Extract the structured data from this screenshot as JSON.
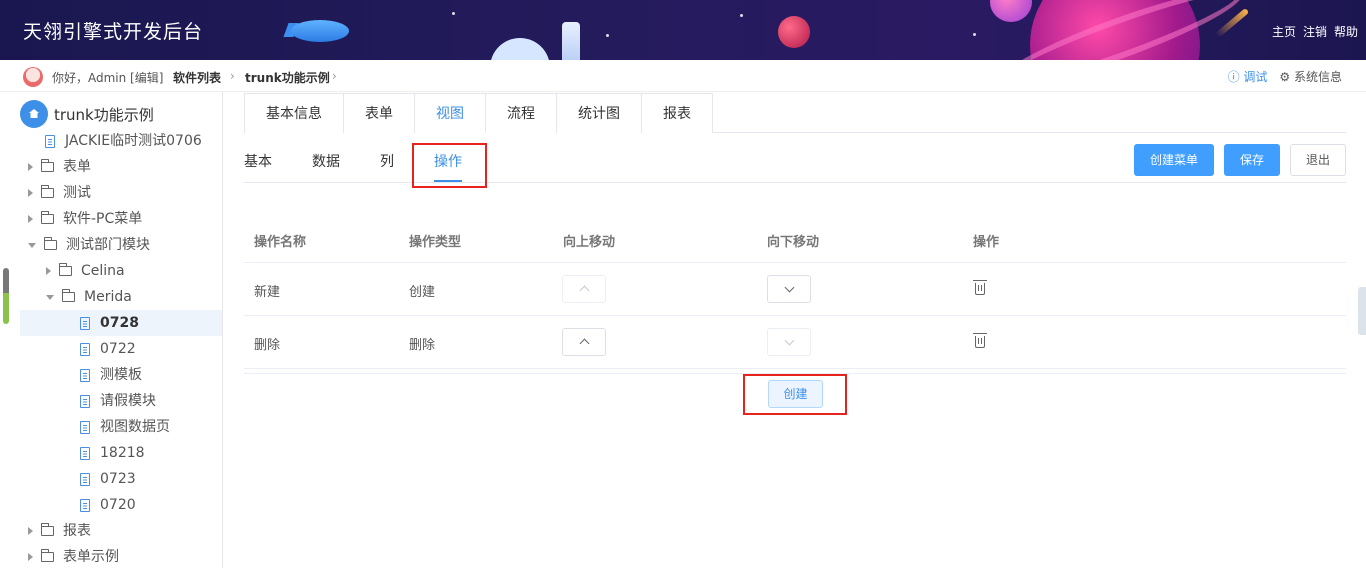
{
  "header": {
    "title": "天翎引擎式开发后台",
    "links": [
      "主页",
      "注销",
      "帮助"
    ]
  },
  "topbar": {
    "greeting": "你好，Admin [编辑]",
    "breadcrumb": [
      "软件列表",
      "trunk功能示例"
    ],
    "debug": "ⓘ 调试",
    "sysinfo": "⚙ 系统信息"
  },
  "sidebar": {
    "root": "trunk功能示例",
    "items": [
      {
        "label": "JACKIE临时测试0706",
        "type": "doc",
        "level": 1
      },
      {
        "label": "表单",
        "type": "folder",
        "level": 1
      },
      {
        "label": "测试",
        "type": "folder",
        "level": 1
      },
      {
        "label": "软件-PC菜单",
        "type": "folder",
        "level": 1
      },
      {
        "label": "测试部门模块",
        "type": "folder-open",
        "level": 1
      },
      {
        "label": "Celina",
        "type": "folder",
        "level": 2
      },
      {
        "label": "Merida",
        "type": "folder-open",
        "level": 2
      },
      {
        "label": "0728",
        "type": "doc",
        "level": 3,
        "selected": true
      },
      {
        "label": "0722",
        "type": "doc",
        "level": 3
      },
      {
        "label": "测模板",
        "type": "doc",
        "level": 3
      },
      {
        "label": "请假模块",
        "type": "doc",
        "level": 3
      },
      {
        "label": "视图数据页",
        "type": "doc",
        "level": 3
      },
      {
        "label": "18218",
        "type": "doc",
        "level": 3
      },
      {
        "label": "0723",
        "type": "doc",
        "level": 3
      },
      {
        "label": "0720",
        "type": "doc",
        "level": 3
      },
      {
        "label": "报表",
        "type": "folder",
        "level": 1
      },
      {
        "label": "表单示例",
        "type": "folder",
        "level": 1
      }
    ]
  },
  "main_tabs": [
    "基本信息",
    "表单",
    "视图",
    "流程",
    "统计图",
    "报表"
  ],
  "main_tab_active": "视图",
  "sub_tabs": [
    "基本",
    "数据",
    "列",
    "操作"
  ],
  "sub_tab_active": "操作",
  "buttons": {
    "create_menu": "创建菜单",
    "save": "保存",
    "exit": "退出",
    "create": "创建"
  },
  "table": {
    "headers": [
      "操作名称",
      "操作类型",
      "向上移动",
      "向下移动",
      "操作"
    ],
    "rows": [
      {
        "name": "新建",
        "type": "创建",
        "up_enabled": false,
        "down_enabled": true
      },
      {
        "name": "删除",
        "type": "删除",
        "up_enabled": true,
        "down_enabled": false
      }
    ]
  },
  "colors": {
    "accent": "#409eff",
    "highlight": "#e8221c",
    "header_bg": "#1a1750"
  }
}
